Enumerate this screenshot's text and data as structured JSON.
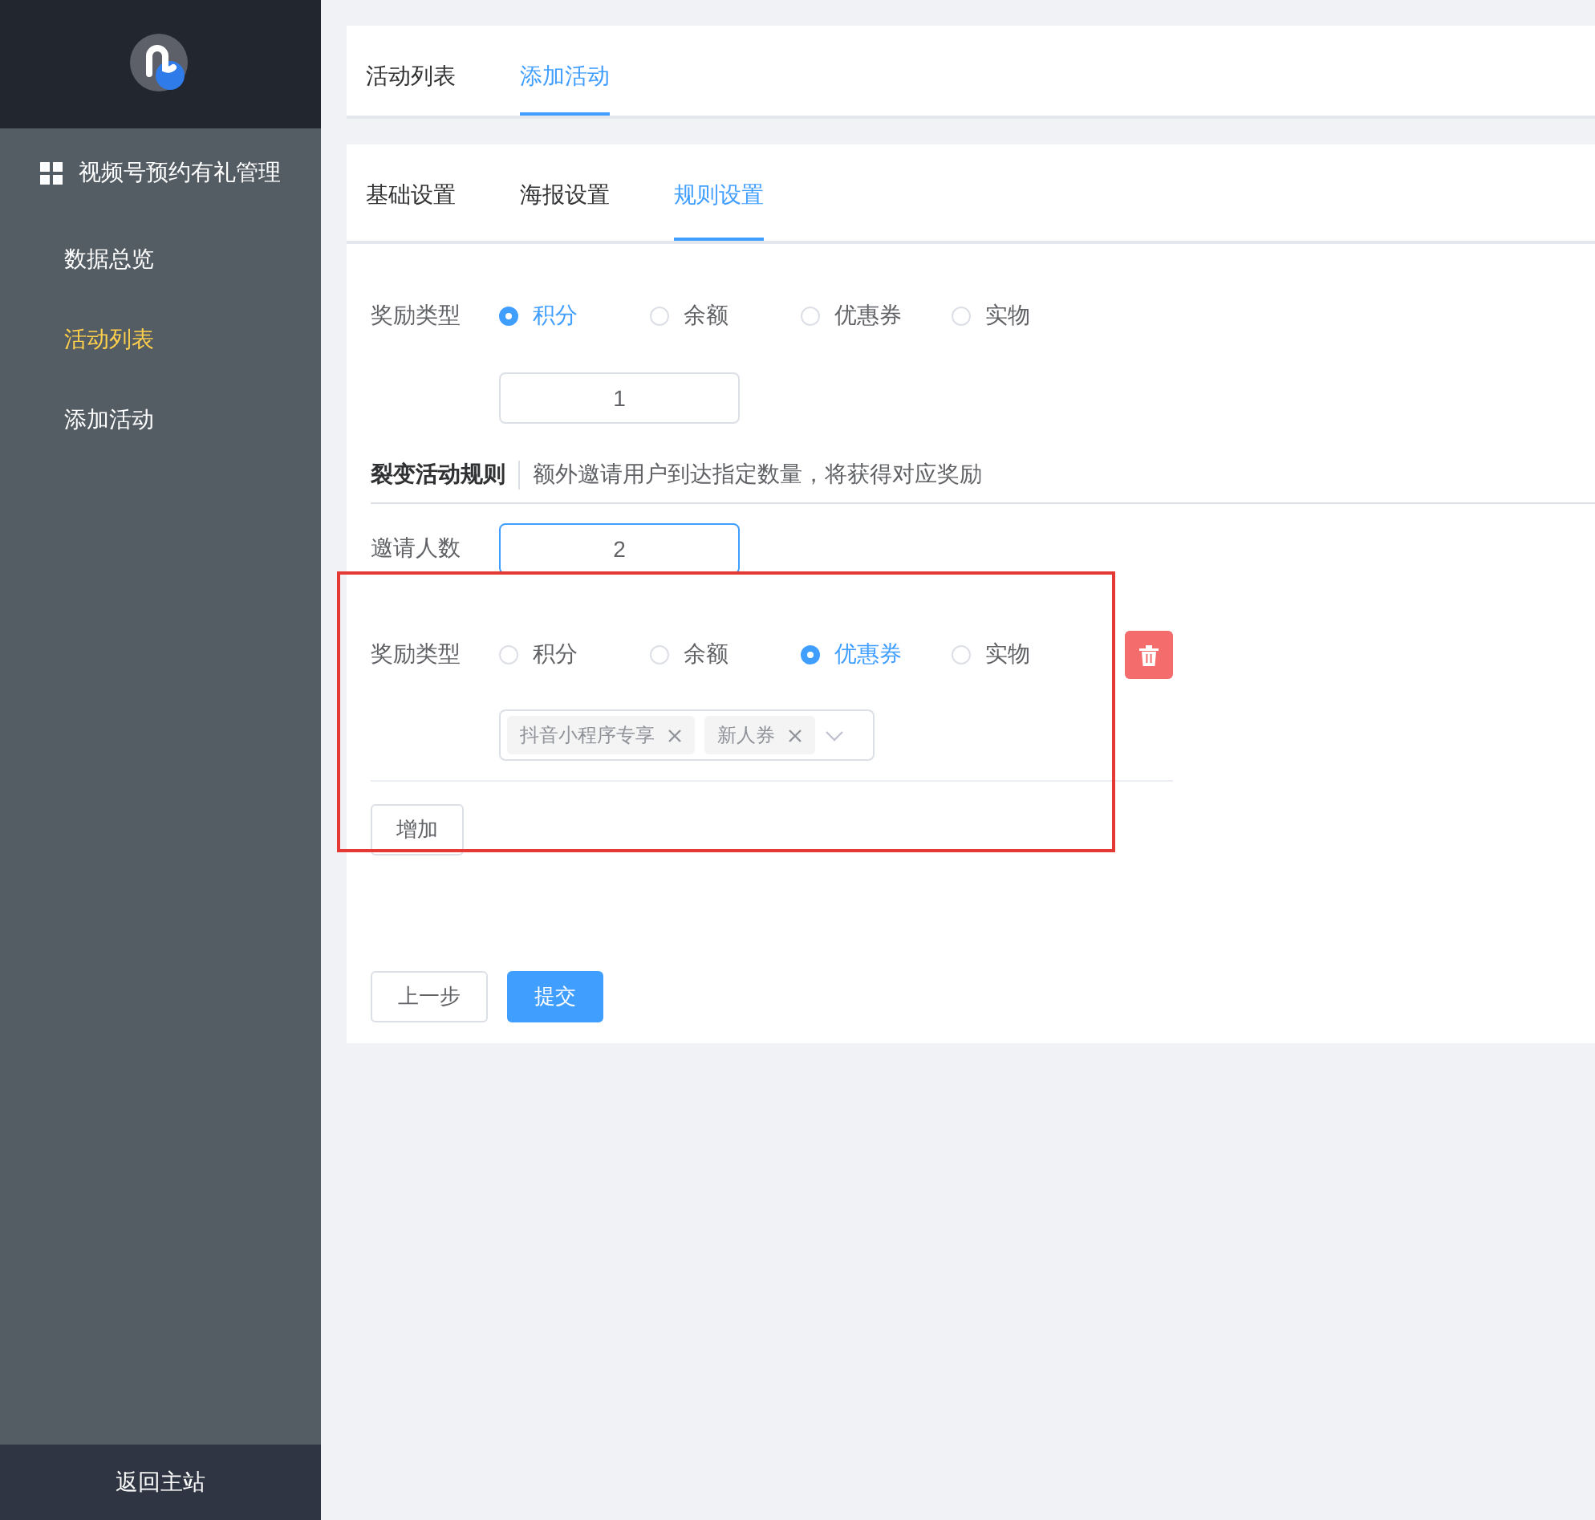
{
  "sidebar": {
    "group_title": "视频号预约有礼管理",
    "items": [
      {
        "label": "数据总览",
        "selected": false
      },
      {
        "label": "活动列表",
        "selected": true
      },
      {
        "label": "添加活动",
        "selected": false
      }
    ],
    "footer_link": "返回主站"
  },
  "nav_tabs": [
    {
      "label": "活动列表",
      "selected": false
    },
    {
      "label": "添加活动",
      "selected": true
    }
  ],
  "sub_tabs": [
    {
      "label": "基础设置",
      "selected": false
    },
    {
      "label": "海报设置",
      "selected": false
    },
    {
      "label": "规则设置",
      "selected": true
    }
  ],
  "base_reward": {
    "label": "奖励类型",
    "options": [
      {
        "label": "积分",
        "selected": true
      },
      {
        "label": "余额",
        "selected": false
      },
      {
        "label": "优惠券",
        "selected": false
      },
      {
        "label": "实物",
        "selected": false
      }
    ],
    "value": "1"
  },
  "fission": {
    "title": "裂变活动规则",
    "description": "额外邀请用户到达指定数量，将获得对应奖励"
  },
  "rules": [
    {
      "invite_label": "邀请人数",
      "invite_value": "2",
      "focused": true,
      "reward_label": "奖励类型",
      "options": [
        {
          "label": "积分",
          "selected": false
        },
        {
          "label": "余额",
          "selected": false
        },
        {
          "label": "优惠券",
          "selected": true
        },
        {
          "label": "实物",
          "selected": false
        }
      ],
      "coupons": [
        "抖音小程序专享",
        "新人券"
      ]
    }
  ],
  "add_button": "增加",
  "prev_button": "上一步",
  "submit_button": "提交"
}
